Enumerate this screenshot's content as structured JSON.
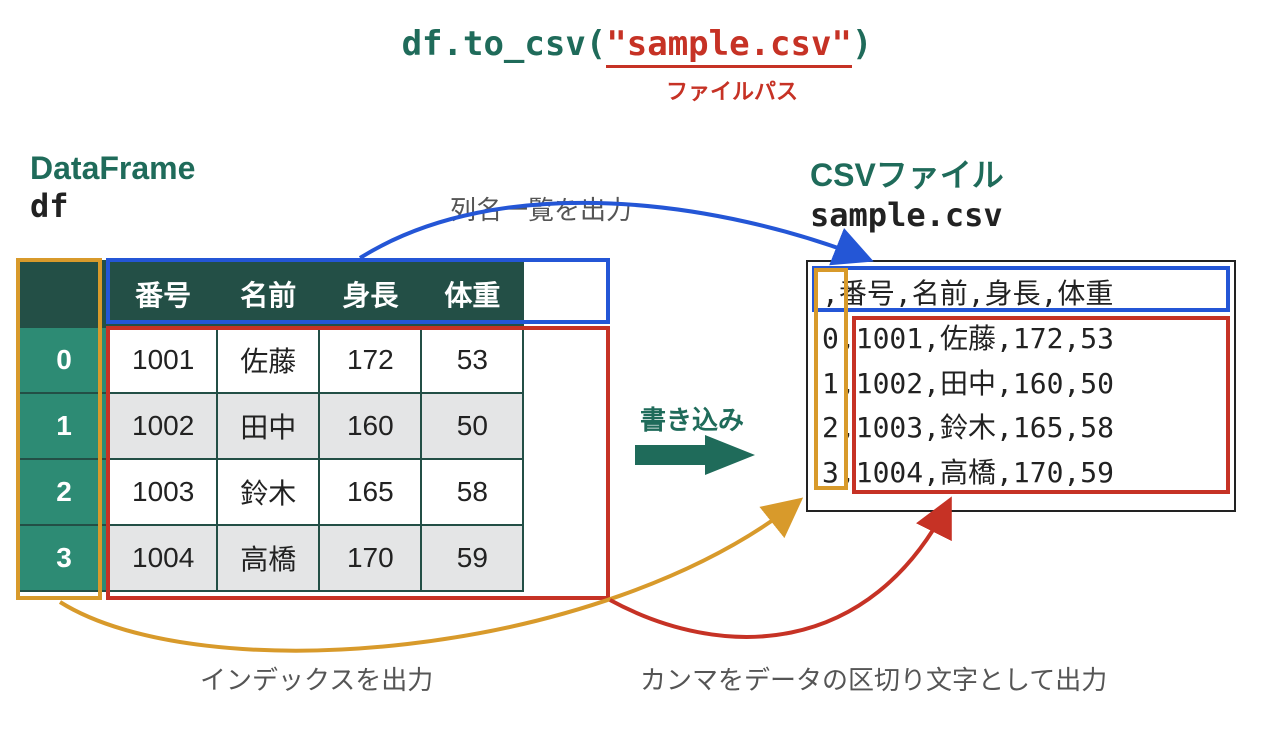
{
  "code": {
    "prefix": "df.to_csv(",
    "filename": "\"sample.csv\"",
    "suffix": ")"
  },
  "labels": {
    "filepath": "ファイルパス",
    "dataframe_heading": "DataFrame",
    "df_var": "df",
    "csv_heading": "CSVファイル",
    "csv_filename": "sample.csv",
    "columns_out": "列名一覧を出力",
    "write": "書き込み",
    "index_out": "インデックスを出力",
    "comma_out": "カンマをデータの区切り文字として出力"
  },
  "dataframe": {
    "columns": [
      "番号",
      "名前",
      "身長",
      "体重"
    ],
    "index": [
      "0",
      "1",
      "2",
      "3"
    ],
    "rows": [
      [
        "1001",
        "佐藤",
        "172",
        "53"
      ],
      [
        "1002",
        "田中",
        "160",
        "50"
      ],
      [
        "1003",
        "鈴木",
        "165",
        "58"
      ],
      [
        "1004",
        "高橋",
        "170",
        "59"
      ]
    ]
  },
  "csv": {
    "lines": [
      ",番号,名前,身長,体重",
      "0,1001,佐藤,172,53",
      "1,1002,田中,160,50",
      "2,1003,鈴木,165,58",
      "3,1004,高橋,170,59"
    ]
  },
  "colors": {
    "teal": "#1f6b5a",
    "red": "#c63225",
    "blue": "#2456d6",
    "orange": "#d89a2b"
  }
}
